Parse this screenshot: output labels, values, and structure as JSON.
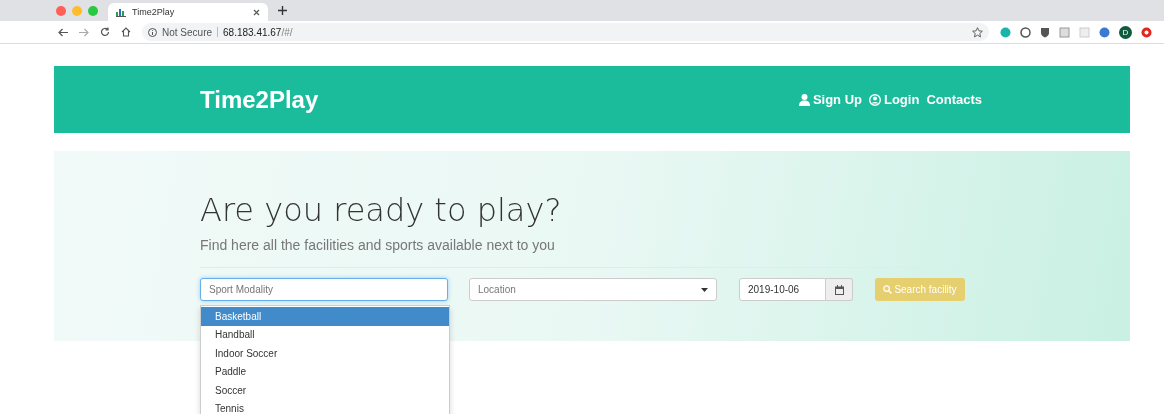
{
  "browser": {
    "tab_title": "Time2Play",
    "security": "Not Secure",
    "url_host": "68.183.41.67",
    "url_path": "/#/",
    "profile": "D"
  },
  "header": {
    "brand": "Time2Play",
    "nav": [
      {
        "label": "Sign Up",
        "kind": "user"
      },
      {
        "label": "Login",
        "kind": "login"
      },
      {
        "label": "Contacts",
        "kind": "plain"
      }
    ]
  },
  "hero": {
    "title": "Are you ready to play?",
    "subtitle": "Find here all the facilities and sports available next to you"
  },
  "search": {
    "sport_placeholder": "Sport Modality",
    "location_placeholder": "Location",
    "date": "2019-10-06",
    "button": "Search facility",
    "options": [
      {
        "label": "Basketball",
        "selected": true
      },
      {
        "label": "Handball",
        "selected": false
      },
      {
        "label": "Indoor Soccer",
        "selected": false
      },
      {
        "label": "Paddle",
        "selected": false
      },
      {
        "label": "Soccer",
        "selected": false
      },
      {
        "label": "Tennis",
        "selected": false
      }
    ]
  }
}
